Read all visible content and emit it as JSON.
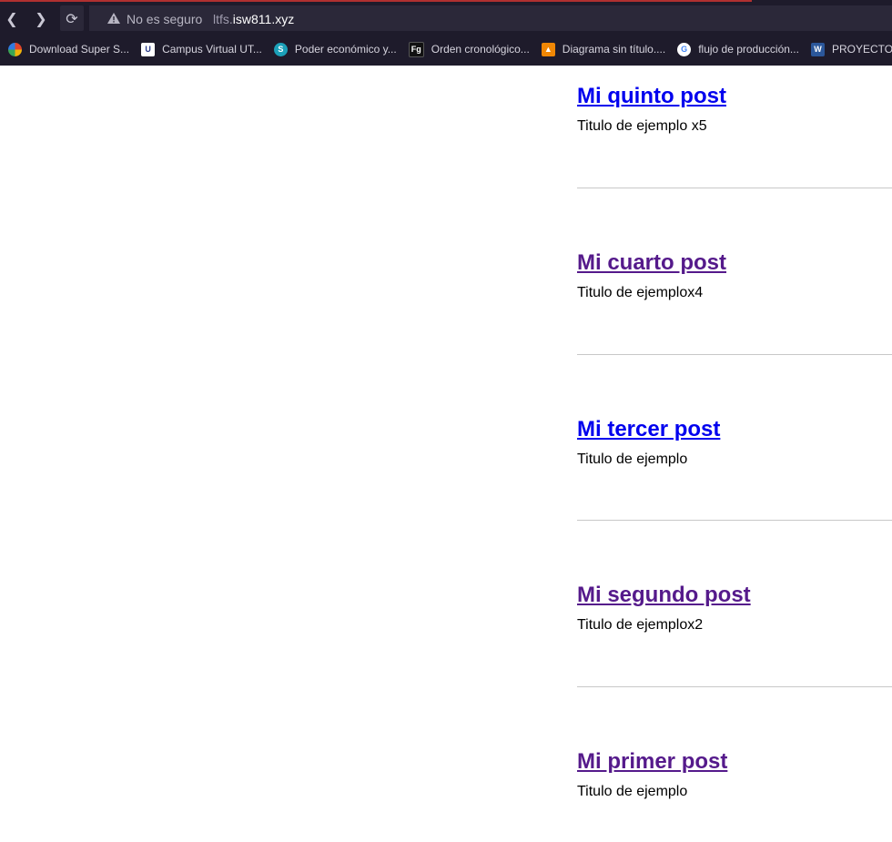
{
  "browser": {
    "security_label": "No es seguro",
    "url_prefix": "ltfs.",
    "url_host": "isw811.xyz"
  },
  "bookmarks": [
    {
      "label": "Download Super S...",
      "icon": "colorful-circle-icon",
      "color": "#e0442a"
    },
    {
      "label": "Campus Virtual UT...",
      "icon": "utn-logo-icon",
      "color": "#2a3a8a"
    },
    {
      "label": "Poder económico y...",
      "icon": "teal-circle-icon",
      "color": "#1ba0b8"
    },
    {
      "label": "Orden cronológico...",
      "icon": "fg-logo-icon",
      "color": "#111111"
    },
    {
      "label": "Diagrama sin título....",
      "icon": "drawio-icon",
      "color": "#f08705"
    },
    {
      "label": "flujo de producción...",
      "icon": "google-icon",
      "color": "#ffffff"
    },
    {
      "label": "PROYECTO DE",
      "icon": "word-icon",
      "color": "#2b579a"
    }
  ],
  "posts": [
    {
      "title": "Mi quinto post",
      "subtitle": "Titulo de ejemplo x5",
      "visited": false
    },
    {
      "title": "Mi cuarto post",
      "subtitle": "Titulo de ejemplox4",
      "visited": true
    },
    {
      "title": "Mi tercer post",
      "subtitle": "Titulo de ejemplo",
      "visited": false
    },
    {
      "title": "Mi segundo post",
      "subtitle": "Titulo de ejemplox2",
      "visited": true
    },
    {
      "title": "Mi primer post",
      "subtitle": "Titulo de ejemplo",
      "visited": true
    }
  ],
  "colors": {
    "link_unvisited": "#0000ee",
    "link_visited": "#551a8b",
    "browser_chrome": "#1e1b2b"
  }
}
